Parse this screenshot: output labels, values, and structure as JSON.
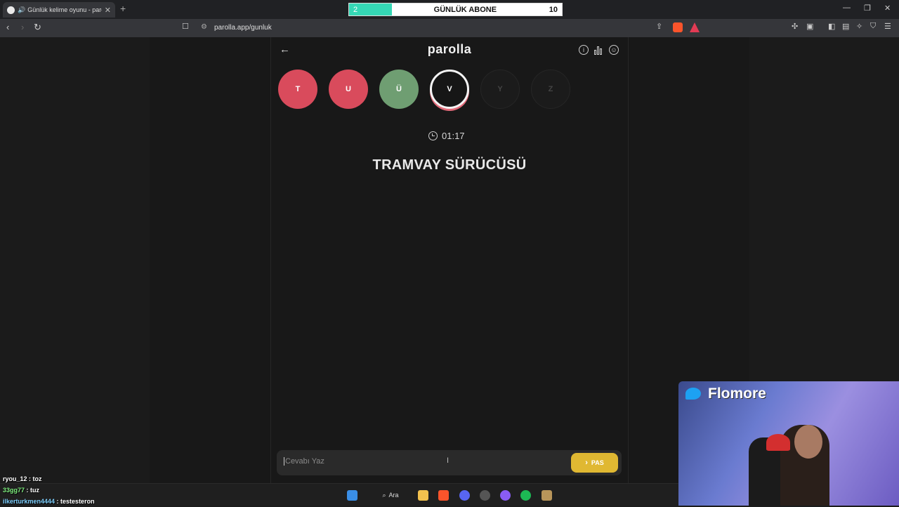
{
  "browser": {
    "tab_title": "Günlük kelime oyunu - parolla",
    "new_tab": "+",
    "url": "parolla.app/gunluk"
  },
  "subscriber_goal": {
    "current": "2",
    "label": "GÜNLÜK ABONE",
    "goal": "10",
    "progress": 0.2,
    "fill_color": "#35d7b5"
  },
  "app": {
    "logo": "parolla",
    "letters": [
      {
        "char": "T",
        "state": "wrong"
      },
      {
        "char": "U",
        "state": "wrong"
      },
      {
        "char": "Ü",
        "state": "correct"
      },
      {
        "char": "V",
        "state": "current"
      },
      {
        "char": "Y",
        "state": "pending"
      },
      {
        "char": "Z",
        "state": "pending"
      }
    ],
    "timer": "01:17",
    "question": "TRAMVAY SÜRÜCÜSÜ",
    "answer_placeholder": "Cevabı Yaz",
    "pass_label": "PAS",
    "colors": {
      "wrong": "#d94b5c",
      "correct": "#6f9e72",
      "pass": "#e0b832"
    }
  },
  "taskbar": {
    "search_label": "Ara"
  },
  "chat": [
    {
      "user": "ryou_12",
      "message": "toz"
    },
    {
      "user": "33gg77",
      "message": "tuz"
    },
    {
      "user": "ilkerturkmen4444",
      "message": "testesteron"
    }
  ],
  "webcam": {
    "name": "Flomore"
  }
}
